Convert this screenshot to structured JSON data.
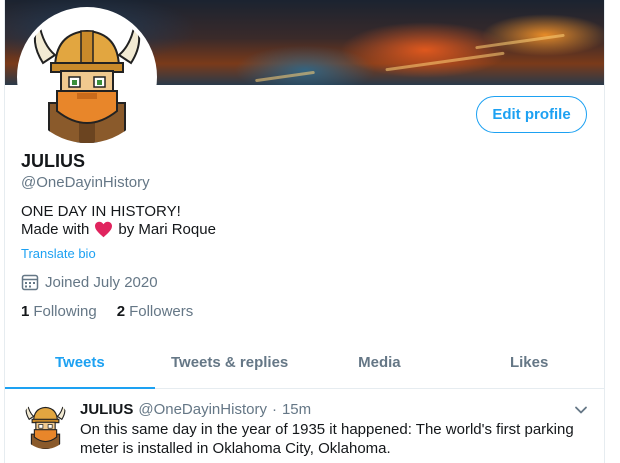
{
  "profile": {
    "name": "JULIUS",
    "handle": "@OneDayinHistory",
    "bio_line1": "ONE DAY IN HISTORY!",
    "bio_made_with": "Made with",
    "bio_by": "by Mari Roque",
    "translate_bio": "Translate bio",
    "joined": "Joined July 2020",
    "following_count": "1",
    "following_label": "Following",
    "followers_count": "2",
    "followers_label": "Followers",
    "edit_profile": "Edit profile"
  },
  "tabs": [
    {
      "label": "Tweets",
      "active": true
    },
    {
      "label": "Tweets & replies",
      "active": false
    },
    {
      "label": "Media",
      "active": false
    },
    {
      "label": "Likes",
      "active": false
    }
  ],
  "tweet": {
    "name": "JULIUS",
    "handle": "@OneDayinHistory",
    "separator": "·",
    "time": "15m",
    "text": "On this same day in the year of 1935 it happened:  The world's first parking meter is installed in Oklahoma City, Oklahoma."
  },
  "colors": {
    "accent": "#1da1f2",
    "heart": "#e0245e",
    "secondary_text": "#657786"
  },
  "icons": {
    "heart": "heart-icon",
    "calendar": "calendar-icon",
    "caret": "chevron-down-icon"
  }
}
